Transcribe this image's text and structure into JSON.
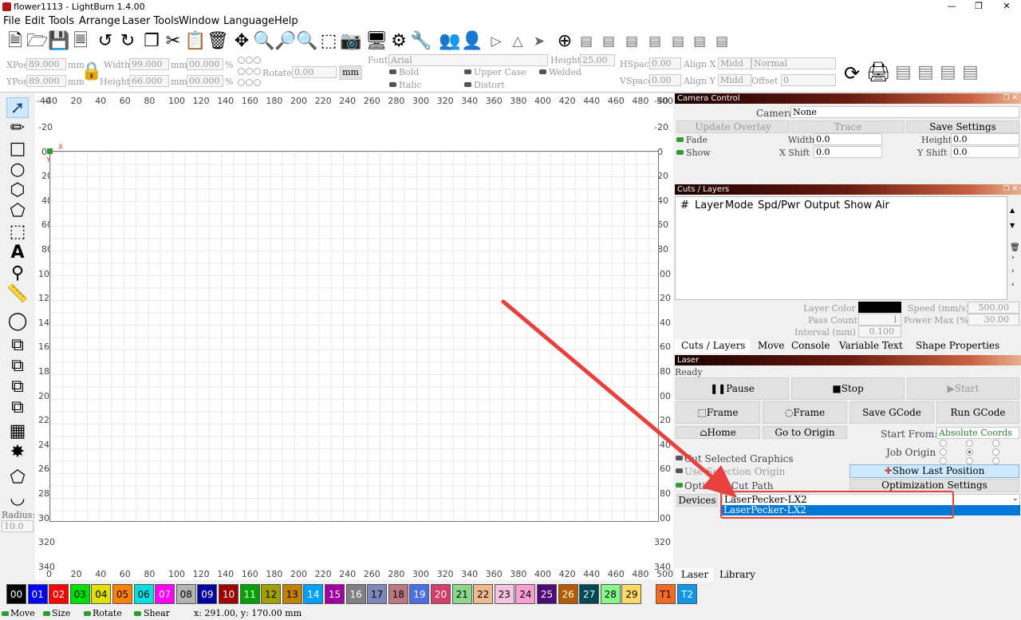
{
  "window": {
    "title": "flower1113 - LightBurn 1.4.00"
  },
  "menu": [
    "File",
    "Edit",
    "Tools",
    "Arrange",
    "Laser Tools",
    "Window",
    "Language",
    "Help"
  ],
  "toolbar2": {
    "xpos_label": "XPos",
    "xpos": "89.000",
    "ypos_label": "YPos",
    "ypos": "89.000",
    "unit": "mm",
    "width_label": "Width",
    "width": "99.000",
    "height_label": "Height",
    "height": "66.000",
    "w_pct": "00.000",
    "h_pct": "00.000",
    "pct": "%",
    "rotate_label": "Rotate",
    "rotate": "0.00",
    "mm_btn": "mm",
    "font_label": "Font",
    "font": "Arial",
    "fheight_label": "Height",
    "fheight": "25.00",
    "bold": "Bold",
    "italic": "Italic",
    "upper": "Upper Case",
    "distort": "Distort",
    "welded": "Welded",
    "hspace_label": "HSpace",
    "hspace": "0.00",
    "vspace_label": "VSpace",
    "vspace": "0.00",
    "alignx_label": "Align X",
    "alignx": "Midd",
    "normal": "Normal",
    "aligny_label": "Align Y",
    "aligny": "Midd",
    "offset_label": "Offset",
    "offset": "0"
  },
  "radius": {
    "label": "Radius:",
    "value": "10.0"
  },
  "ruler": {
    "top": [
      "-40",
      "20",
      "40",
      "60",
      "80",
      "100",
      "120",
      "140",
      "160",
      "180",
      "200",
      "220",
      "240",
      "260",
      "280",
      "300",
      "320",
      "340",
      "360",
      "380",
      "400",
      "420",
      "440",
      "460",
      "480",
      "500"
    ],
    "left": [
      "-20",
      "0",
      "20",
      "40",
      "60",
      "80",
      "100",
      "120",
      "140",
      "160",
      "180",
      "200",
      "220",
      "240",
      "260",
      "280",
      "300",
      "320",
      "340"
    ],
    "left_top": "-40",
    "right": [
      "-20",
      "0",
      "20",
      "40",
      "60",
      "80",
      "100",
      "120",
      "140",
      "160",
      "180",
      "200",
      "220",
      "240",
      "260",
      "280",
      "300",
      "320",
      "340"
    ],
    "right_top": "-40",
    "bottom": [
      "0",
      "20",
      "40",
      "60",
      "80",
      "100",
      "120",
      "140",
      "160",
      "180",
      "200",
      "220",
      "240",
      "260",
      "280",
      "300",
      "320",
      "340",
      "360",
      "380",
      "400",
      "420",
      "440",
      "460",
      "480",
      "500"
    ],
    "axis_x": "X",
    "axis_y": "Y"
  },
  "camera": {
    "title": "Camera Control",
    "camera_label": "Camera:",
    "camera": "None",
    "update": "Update Overlay",
    "trace": "Trace",
    "save": "Save Settings",
    "fade": "Fade",
    "show": "Show",
    "width_label": "Width",
    "width": "0.0",
    "height_label": "Height",
    "height": "0.0",
    "xshift_label": "X Shift",
    "xshift": "0.0",
    "yshift_label": "Y Shift",
    "yshift": "0.0"
  },
  "layers": {
    "title": "Cuts / Layers",
    "cols": [
      "#",
      "Layer",
      "Mode",
      "Spd/Pwr",
      "Output",
      "Show",
      "Air"
    ],
    "layer_color": "Layer Color",
    "speed": "Speed (mm/s)",
    "speed_val": "500.00",
    "pass": "Pass Count",
    "pass_val": "1",
    "power": "Power Max (%)",
    "power_val": "30.00",
    "interval": "Interval (mm)",
    "interval_val": "0.100"
  },
  "tabs1": [
    "Cuts / Layers",
    "Move",
    "Console",
    "Variable Text",
    "Shape Properties"
  ],
  "laser": {
    "title": "Laser",
    "status": "Ready",
    "pause": "Pause",
    "stop": "Stop",
    "start": "Start",
    "frame1": "Frame",
    "frame2": "Frame",
    "save_gcode": "Save GCode",
    "run_gcode": "Run GCode",
    "home": "Home",
    "goto_origin": "Go to Origin",
    "start_from_label": "Start From:",
    "start_from": "Absolute Coords",
    "job_origin": "Job Origin",
    "cut_selected": "Cut Selected Graphics",
    "use_selection": "Use Selection Origin",
    "show_last": "Show Last Position",
    "optimize": "Optimize Cut Path",
    "opt_settings": "Optimization Settings",
    "devices": "Devices",
    "device": "LaserPecker-LX2",
    "device_option": "LaserPecker-LX2"
  },
  "tabs2": [
    "Laser",
    "Library"
  ],
  "palette": [
    {
      "l": "00",
      "c": "#000000",
      "t": "#ffffff"
    },
    {
      "l": "01",
      "c": "#0000ff",
      "t": "#ffffff"
    },
    {
      "l": "02",
      "c": "#ff0000",
      "t": "#ffffff"
    },
    {
      "l": "03",
      "c": "#00e000",
      "t": "#000000"
    },
    {
      "l": "04",
      "c": "#e0e000",
      "t": "#000000"
    },
    {
      "l": "05",
      "c": "#ff8000",
      "t": "#000000"
    },
    {
      "l": "06",
      "c": "#00e0e0",
      "t": "#000000"
    },
    {
      "l": "07",
      "c": "#ff00ff",
      "t": "#ffffff"
    },
    {
      "l": "08",
      "c": "#b4b4b4",
      "t": "#000000"
    },
    {
      "l": "09",
      "c": "#0000a0",
      "t": "#ffffff"
    },
    {
      "l": "10",
      "c": "#a00000",
      "t": "#ffffff"
    },
    {
      "l": "11",
      "c": "#00a000",
      "t": "#ffffff"
    },
    {
      "l": "12",
      "c": "#a0a000",
      "t": "#000000"
    },
    {
      "l": "13",
      "c": "#c08000",
      "t": "#000000"
    },
    {
      "l": "14",
      "c": "#00a0ff",
      "t": "#ffffff"
    },
    {
      "l": "15",
      "c": "#a000a0",
      "t": "#ffffff"
    },
    {
      "l": "16",
      "c": "#808080",
      "t": "#ffffff"
    },
    {
      "l": "17",
      "c": "#7d87b9",
      "t": "#000000"
    },
    {
      "l": "18",
      "c": "#bb7784",
      "t": "#000000"
    },
    {
      "l": "19",
      "c": "#4a6fe3",
      "t": "#ffffff"
    },
    {
      "l": "20",
      "c": "#d33f6a",
      "t": "#ffffff"
    },
    {
      "l": "21",
      "c": "#8cd78c",
      "t": "#000000"
    },
    {
      "l": "22",
      "c": "#f0b98d",
      "t": "#000000"
    },
    {
      "l": "23",
      "c": "#f6c4e1",
      "t": "#000000"
    },
    {
      "l": "24",
      "c": "#fa9ed4",
      "t": "#000000"
    },
    {
      "l": "25",
      "c": "#500a78",
      "t": "#ffffff"
    },
    {
      "l": "26",
      "c": "#b45a00",
      "t": "#ffffff"
    },
    {
      "l": "27",
      "c": "#004754",
      "t": "#ffffff"
    },
    {
      "l": "28",
      "c": "#86fa88",
      "t": "#000000"
    },
    {
      "l": "29",
      "c": "#ffdb66",
      "t": "#000000"
    },
    {
      "l": "T1",
      "c": "#f36926",
      "t": "#000000"
    },
    {
      "l": "T2",
      "c": "#0f97e6",
      "t": "#ffffff"
    }
  ],
  "status": {
    "move": "Move",
    "size": "Size",
    "rotate": "Rotate",
    "shear": "Shear",
    "coords": "x: 291.00, y: 170.00 mm"
  },
  "colors": {
    "annotation": "#e8413d",
    "selection": "#0078d7"
  }
}
